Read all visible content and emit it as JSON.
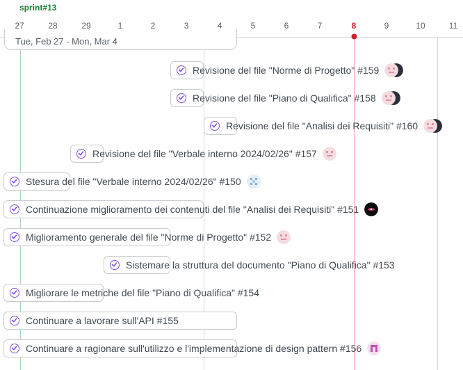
{
  "sprint": {
    "label": "sprint#13"
  },
  "date_range": "Tue, Feb 27 - Mon, Mar 4",
  "days": [
    "27",
    "28",
    "29",
    "1",
    "2",
    "3",
    "4",
    "5",
    "6",
    "7",
    "8",
    "9",
    "10",
    "11"
  ],
  "today": "8",
  "colors": {
    "accent": "#8250df",
    "today": "#cf222e",
    "sprint": "#1a7f37"
  },
  "items": [
    {
      "title": "Revisione del file \"Norme di Progetto\" #159",
      "avatars": [
        "pink-robot-avatar",
        "dark-moon-avatar"
      ]
    },
    {
      "title": "Revisione del file \"Piano di Qualifica\" #158",
      "avatars": [
        "pink-robot-avatar",
        "dark-moon-avatar"
      ]
    },
    {
      "title": "Revisione del file \"Analisi dei Requisiti\" #160",
      "avatars": [
        "pink-robot-avatar",
        "dark-moon-avatar"
      ]
    },
    {
      "title": "Revisione del file \"Verbale interno 2024/02/26\" #157",
      "avatars": [
        "pink-robot-avatar"
      ]
    },
    {
      "title": "Stesura del file \"Verbale interno 2024/02/26\" #150",
      "avatars": [
        "blue-pixel-avatar"
      ]
    },
    {
      "title": "Continuazione miglioramento dei contenuti del file \"Analisi dei Requisiti\" #151",
      "avatars": [
        "black-eye-avatar"
      ]
    },
    {
      "title": "Miglioramento generale del file \"Norme di Progetto\" #152",
      "avatars": [
        "pink-robot-avatar"
      ]
    },
    {
      "title": "Sistemare la struttura del documento \"Piano di Qualifica\" #153",
      "avatars": []
    },
    {
      "title": "Migliorare le metriche del file \"Piano di Qualifica\" #154",
      "avatars": []
    },
    {
      "title": "Continuare a lavorare sull'API #155",
      "avatars": []
    },
    {
      "title": "Continuare a ragionare sull'utilizzo e l'implementazione di design pattern #156",
      "avatars": [
        "magenta-pixel-avatar"
      ]
    }
  ]
}
